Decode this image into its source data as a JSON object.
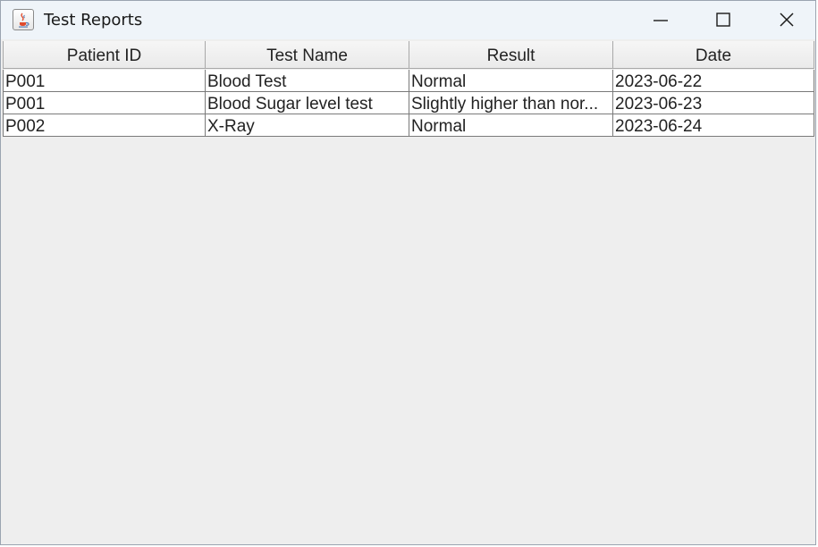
{
  "window": {
    "title": "Test Reports",
    "icon": "java-cup-icon"
  },
  "controls": {
    "minimize": "minimize-icon",
    "maximize": "maximize-icon",
    "close": "close-icon"
  },
  "table": {
    "columns": [
      "Patient ID",
      "Test Name",
      "Result",
      "Date"
    ],
    "rows": [
      [
        "P001",
        "Blood Test",
        "Normal",
        "2023-06-22"
      ],
      [
        "P001",
        "Blood Sugar level test",
        "Slightly higher than nor...",
        "2023-06-23"
      ],
      [
        "P002",
        "X-Ray",
        "Normal",
        "2023-06-24"
      ]
    ]
  }
}
